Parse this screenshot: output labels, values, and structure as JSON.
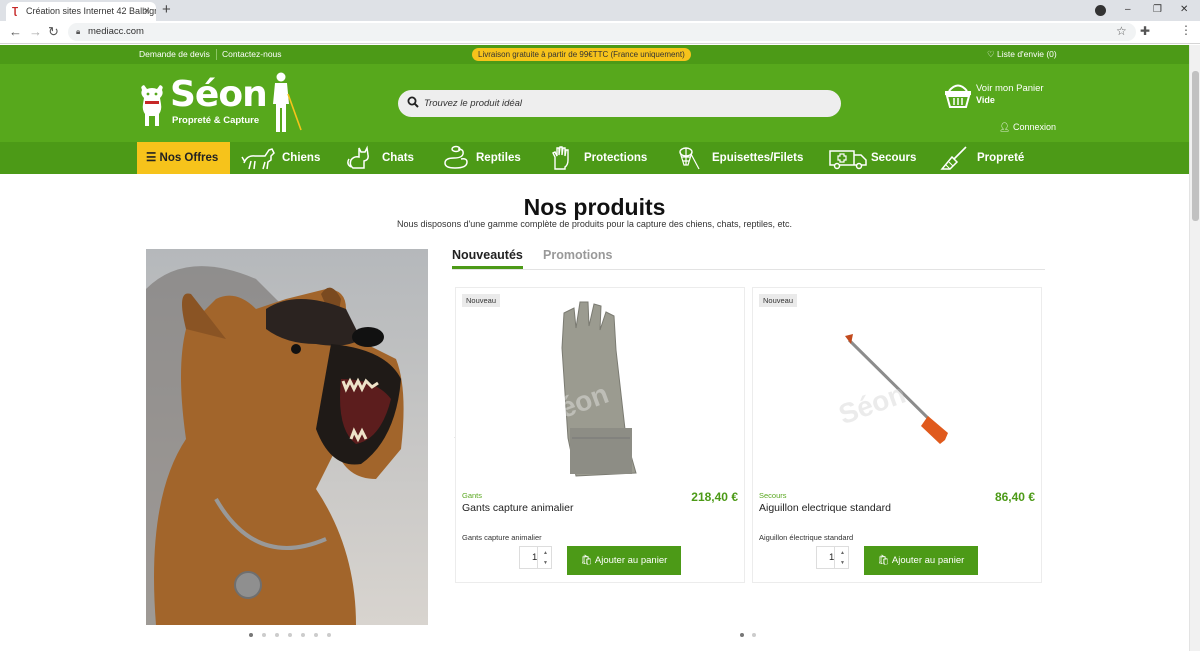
{
  "browser": {
    "tab_title": "Création sites Internet 42 Balbigny",
    "url": "mediacc.com"
  },
  "topbar": {
    "quote_link": "Demande de devis",
    "contact_link": "Contactez-nous",
    "promo": "Livraison gratuite à partir de 99€TTC (France uniquement)",
    "wishlist": "Liste d'envie (0)"
  },
  "header": {
    "logo_title": "Séon",
    "logo_subtitle": "Propreté & Capture",
    "search_placeholder": "Trouvez le produit idéal",
    "cart_label": "Voir mon Panier",
    "cart_status": "Vide",
    "login": "Connexion"
  },
  "nav": {
    "offers": "Nos Offres",
    "items": [
      {
        "label": "Chiens",
        "icon": "dog-icon"
      },
      {
        "label": "Chats",
        "icon": "cat-icon"
      },
      {
        "label": "Reptiles",
        "icon": "snake-icon"
      },
      {
        "label": "Protections",
        "icon": "glove-icon"
      },
      {
        "label": "Epuisettes/Filets",
        "icon": "net-icon"
      },
      {
        "label": "Secours",
        "icon": "ambulance-icon"
      },
      {
        "label": "Propreté",
        "icon": "broom-icon"
      }
    ]
  },
  "main": {
    "title": "Nos produits",
    "subtitle": "Nous disposons d'une gamme complète de produits pour la capture des chiens, chats, reptiles, etc.",
    "tabs": [
      "Nouveautés",
      "Promotions"
    ],
    "products": [
      {
        "badge": "Nouveau",
        "category": "Gants",
        "name": "Gants capture animalier",
        "price": "218,40 €",
        "description": "Gants capture animalier",
        "quantity": "1",
        "add_label": "Ajouter au panier"
      },
      {
        "badge": "Nouveau",
        "category": "Secours",
        "name": "Aiguillon electrique standard",
        "price": "86,40 €",
        "description": "Aiguillon électrique standard",
        "quantity": "1",
        "add_label": "Ajouter au panier"
      }
    ]
  },
  "colors": {
    "brand_green": "#57a81c",
    "dark_green": "#4c9a17",
    "accent_yellow": "#f6c31b"
  }
}
